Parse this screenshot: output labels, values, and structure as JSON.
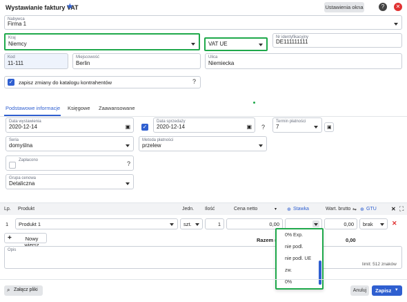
{
  "window": {
    "title": "Wystawianie faktury VAT",
    "settings_button": "Ustawienia okna"
  },
  "header_fields": {
    "name": {
      "label": "Nabywca",
      "value": "Firma 1"
    },
    "country": {
      "label": "Kraj",
      "value": "Niemcy"
    },
    "vat_type": {
      "value": "VAT UE"
    },
    "tax_id": {
      "label": "Nr identyfikacyjny",
      "value": "DE111111111"
    },
    "postal": {
      "label": "Kod",
      "value": "11-111"
    },
    "city": {
      "label": "Miejscowość",
      "value": "Berlin"
    },
    "street": {
      "label": "Ulica",
      "value": "Niemiecka"
    },
    "save_changes": {
      "label": "zapisz zmiany do katalogu kontrahentów",
      "checked": true
    }
  },
  "tabs": [
    "Podstawowe informacje",
    "Księgowe",
    "Zaawansowane"
  ],
  "basic": {
    "issue_date": {
      "label": "Data wystawienia",
      "value": "2020-12-14"
    },
    "sale_date": {
      "label": "Data sprzedaży",
      "value": "2020-12-14"
    },
    "payment_term": {
      "label": "Termin płatności",
      "value": "7"
    },
    "series": {
      "label": "Seria",
      "value": "domyślna"
    },
    "payment_method": {
      "label": "Metoda płatności",
      "value": "przelew"
    },
    "paid": {
      "label": "Zapłacono"
    },
    "price_group": {
      "label": "Grupa cenowa",
      "value": "Detaliczna"
    }
  },
  "table": {
    "headers": {
      "lp": "Lp.",
      "product": "Produkt",
      "unit": "Jedn.",
      "qty": "Ilość",
      "price": "Cena netto",
      "rate": "Stawka",
      "gross": "Wart. brutto",
      "gtu": "GTU"
    },
    "row": {
      "lp": "1",
      "product": "Produkt 1",
      "unit": "szt.",
      "qty": "1",
      "price": "0,00",
      "gross": "0,00",
      "gtu": "brak"
    },
    "new_row_button": "Nowy wiersz",
    "total_label": "Razem (P",
    "total_value": "0,00"
  },
  "rate_dropdown": {
    "options": [
      "0% Exp.",
      "nie podl.",
      "nie podl. UE",
      "zw.",
      "0%"
    ]
  },
  "notes": {
    "label": "Opis",
    "limit": "limit: 512 znaków"
  },
  "footer": {
    "attach": "Załącz pliki",
    "cancel": "Anuluj",
    "save": "Zapisz"
  },
  "colors": {
    "accent": "#2f5fd0",
    "highlight": "#1ea84a",
    "delete": "#e03131"
  }
}
